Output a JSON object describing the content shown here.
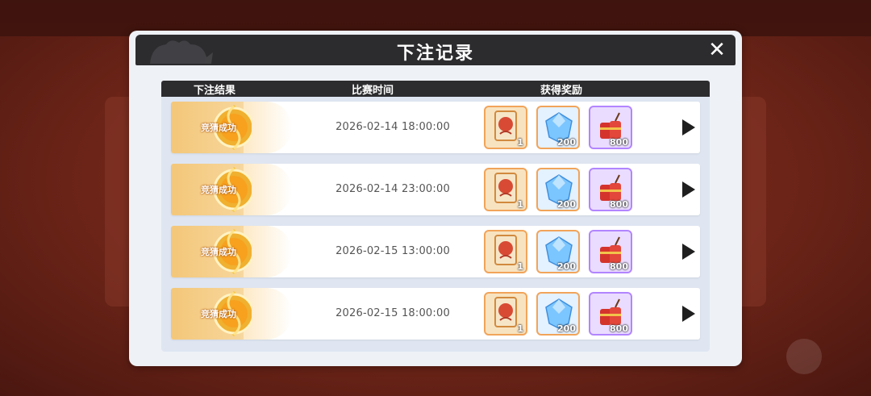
{
  "modal": {
    "title": "下注记录",
    "close_symbol": "✕"
  },
  "table": {
    "headers": {
      "result": "下注结果",
      "time": "比赛时间",
      "reward": "获得奖励"
    },
    "rows": [
      {
        "result": "竞猜成功",
        "time": "2026-02-14  18:00:00",
        "rewards": {
          "card": "1",
          "gem": "200",
          "firecracker": "800"
        }
      },
      {
        "result": "竞猜成功",
        "time": "2026-02-14  23:00:00",
        "rewards": {
          "card": "1",
          "gem": "200",
          "firecracker": "800"
        }
      },
      {
        "result": "竞猜成功",
        "time": "2026-02-15  13:00:00",
        "rewards": {
          "card": "1",
          "gem": "200",
          "firecracker": "800"
        }
      },
      {
        "result": "竞猜成功",
        "time": "2026-02-15  18:00:00",
        "rewards": {
          "card": "1",
          "gem": "200",
          "firecracker": "800"
        }
      }
    ]
  },
  "icons": [
    "close-icon",
    "success-badge-icon",
    "card-icon",
    "gem-icon",
    "firecracker-icon",
    "play-arrow-icon"
  ],
  "colors": {
    "header": "#2c2c2f",
    "modal_bg": "#eef1f6",
    "badge_gold": "#f1b53a",
    "reward_orange_border": "#f1a45a",
    "reward_purple_border": "#b285ff"
  }
}
